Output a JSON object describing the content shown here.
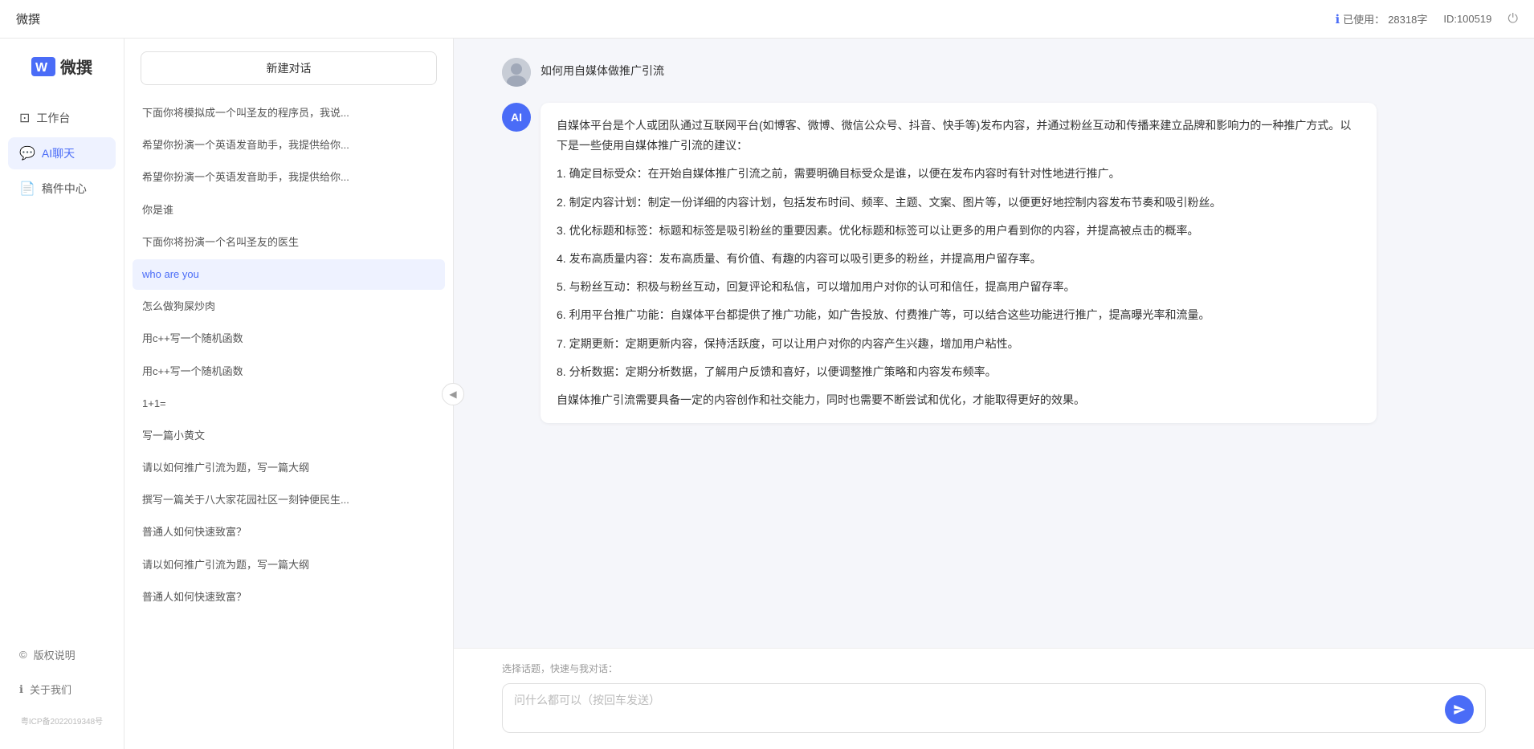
{
  "topbar": {
    "title": "微撰",
    "usage_label": "已使用：",
    "usage_count": "28318字",
    "id_label": "ID:100519",
    "power_icon": "⏻"
  },
  "logo": {
    "text": "微撰"
  },
  "nav": {
    "items": [
      {
        "id": "workbench",
        "label": "工作台",
        "icon": "⊡"
      },
      {
        "id": "ai-chat",
        "label": "AI聊天",
        "icon": "💬",
        "active": true
      },
      {
        "id": "draft",
        "label": "稿件中心",
        "icon": "📄"
      }
    ]
  },
  "sidebar_bottom": {
    "items": [
      {
        "id": "copyright",
        "label": "版权说明",
        "icon": "©"
      },
      {
        "id": "about",
        "label": "关于我们",
        "icon": "ℹ"
      }
    ],
    "icp": "粤ICP备2022019348号"
  },
  "middle_panel": {
    "new_chat_label": "新建对话",
    "history": [
      {
        "id": 1,
        "text": "下面你将模拟成一个叫圣友的程序员，我说...",
        "active": false
      },
      {
        "id": 2,
        "text": "希望你扮演一个英语发音助手，我提供给你...",
        "active": false
      },
      {
        "id": 3,
        "text": "希望你扮演一个英语发音助手，我提供给你...",
        "active": false
      },
      {
        "id": 4,
        "text": "你是谁",
        "active": false
      },
      {
        "id": 5,
        "text": "下面你将扮演一个名叫圣友的医生",
        "active": false
      },
      {
        "id": 6,
        "text": "who are you",
        "active": true
      },
      {
        "id": 7,
        "text": "怎么做狗屎炒肉",
        "active": false
      },
      {
        "id": 8,
        "text": "用c++写一个随机函数",
        "active": false
      },
      {
        "id": 9,
        "text": "用c++写一个随机函数",
        "active": false
      },
      {
        "id": 10,
        "text": "1+1=",
        "active": false
      },
      {
        "id": 11,
        "text": "写一篇小黄文",
        "active": false
      },
      {
        "id": 12,
        "text": "请以如何推广引流为题，写一篇大纲",
        "active": false
      },
      {
        "id": 13,
        "text": "撰写一篇关于八大家花园社区一刻钟便民生...",
        "active": false
      },
      {
        "id": 14,
        "text": "普通人如何快速致富？",
        "active": false
      },
      {
        "id": 15,
        "text": "请以如何推广引流为题，写一篇大纲",
        "active": false
      },
      {
        "id": 16,
        "text": "普通人如何快速致富？",
        "active": false
      }
    ]
  },
  "chat": {
    "user_message": "如何用自媒体做推广引流",
    "ai_response": {
      "paragraphs": [
        "自媒体平台是个人或团队通过互联网平台(如博客、微博、微信公众号、抖音、快手等)发布内容，并通过粉丝互动和传播来建立品牌和影响力的一种推广方式。以下是一些使用自媒体推广引流的建议：",
        "1. 确定目标受众：在开始自媒体推广引流之前，需要明确目标受众是谁，以便在发布内容时有针对性地进行推广。",
        "2. 制定内容计划：制定一份详细的内容计划，包括发布时间、频率、主题、文案、图片等，以便更好地控制内容发布节奏和吸引粉丝。",
        "3. 优化标题和标签：标题和标签是吸引粉丝的重要因素。优化标题和标签可以让更多的用户看到你的内容，并提高被点击的概率。",
        "4. 发布高质量内容：发布高质量、有价值、有趣的内容可以吸引更多的粉丝，并提高用户留存率。",
        "5. 与粉丝互动：积极与粉丝互动，回复评论和私信，可以增加用户对你的认可和信任，提高用户留存率。",
        "6. 利用平台推广功能：自媒体平台都提供了推广功能，如广告投放、付费推广等，可以结合这些功能进行推广，提高曝光率和流量。",
        "7. 定期更新：定期更新内容，保持活跃度，可以让用户对你的内容产生兴趣，增加用户粘性。",
        "8. 分析数据：定期分析数据，了解用户反馈和喜好，以便调整推广策略和内容发布频率。",
        "自媒体推广引流需要具备一定的内容创作和社交能力，同时也需要不断尝试和优化，才能取得更好的效果。"
      ]
    },
    "input_placeholder": "问什么都可以（按回车发送）",
    "quick_topics_label": "选择话题，快速与我对话："
  }
}
